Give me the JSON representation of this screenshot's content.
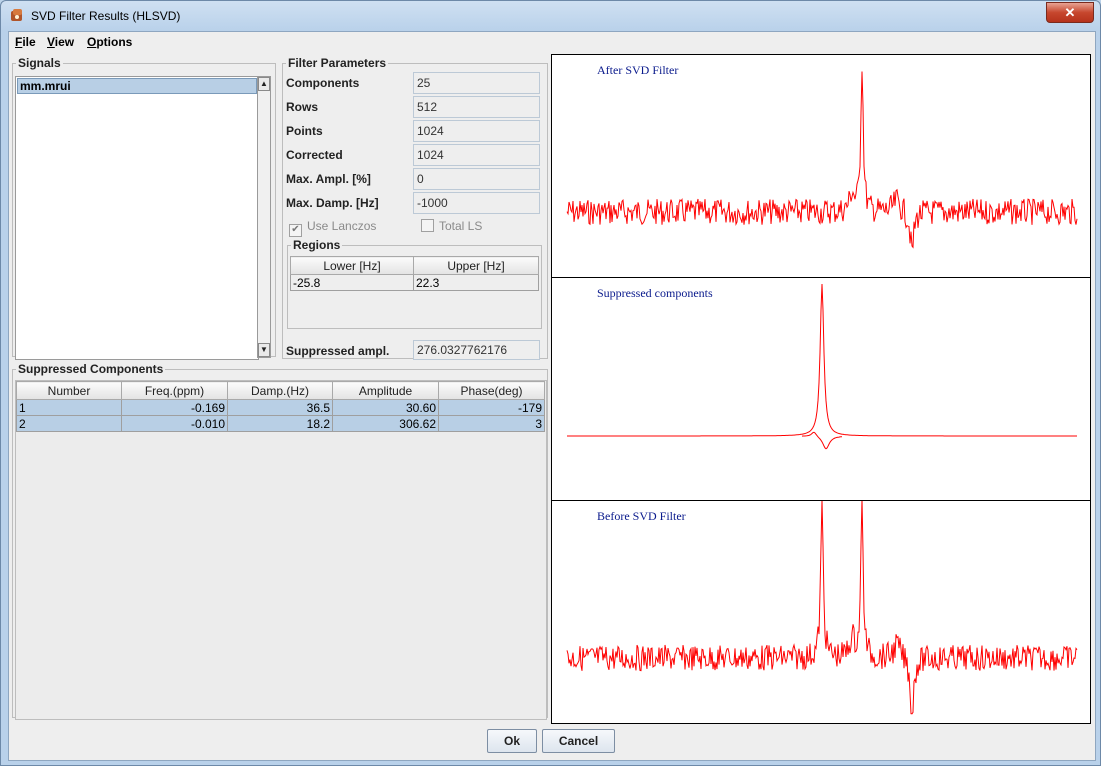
{
  "window": {
    "title": "SVD Filter Results (HLSVD)",
    "close_glyph": "✕"
  },
  "menu": [
    {
      "accel": "F",
      "rest": "ile"
    },
    {
      "accel": "V",
      "rest": "iew"
    },
    {
      "accel": "O",
      "rest": "ptions"
    }
  ],
  "signals": {
    "legend": "Signals",
    "items": [
      "mm.mrui"
    ]
  },
  "filter_params": {
    "legend": "Filter Parameters",
    "rows": [
      {
        "label": "Components",
        "value": "25"
      },
      {
        "label": "Rows",
        "value": "512"
      },
      {
        "label": "Points",
        "value": "1024"
      },
      {
        "label": "Corrected",
        "value": "1024"
      },
      {
        "label": "Max. Ampl. [%]",
        "value": "0"
      },
      {
        "label": "Max. Damp. [Hz]",
        "value": "-1000"
      }
    ],
    "use_lanczos": {
      "label": "Use Lanczos",
      "checked": true
    },
    "total_ls": {
      "label": "Total LS",
      "checked": false
    },
    "regions": {
      "legend": "Regions",
      "headers": [
        "Lower [Hz]",
        "Upper [Hz]"
      ],
      "rows": [
        [
          "-25.8",
          "22.3"
        ]
      ]
    },
    "suppressed_ampl": {
      "label": "Suppressed ampl.",
      "value": "276.0327762176"
    }
  },
  "suppressed_components": {
    "legend": "Suppressed Components",
    "headers": [
      "Number",
      "Freq.(ppm)",
      "Damp.(Hz)",
      "Amplitude",
      "Phase(deg)"
    ],
    "rows": [
      [
        "1",
        "-0.169",
        "36.5",
        "30.60",
        "-179"
      ],
      [
        "2",
        "-0.010",
        "18.2",
        "306.62",
        "3"
      ]
    ]
  },
  "charts": {
    "after": {
      "title": "After SVD Filter"
    },
    "suppressed": {
      "title": "Suppressed components"
    },
    "before": {
      "title": "Before SVD Filter"
    },
    "line_color": "#ff0000"
  },
  "buttons": {
    "ok": "Ok",
    "cancel": "Cancel"
  }
}
